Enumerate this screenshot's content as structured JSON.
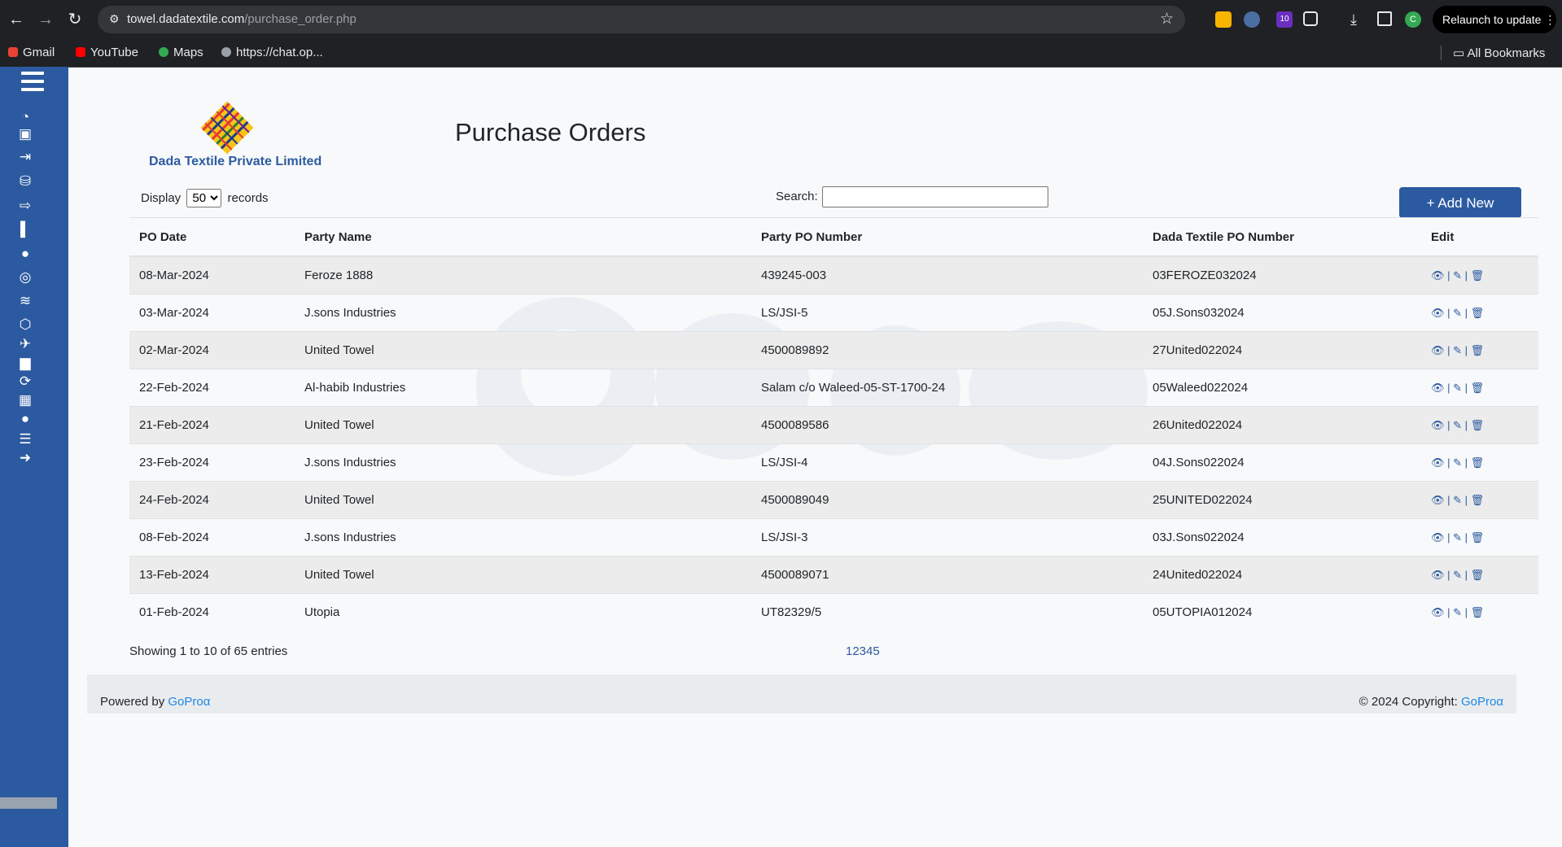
{
  "browser": {
    "url_domain": "towel.dadatextile.com",
    "url_path": "/purchase_order.php",
    "relaunch_label": "Relaunch to update",
    "ext_badge": "10",
    "profile_initial": "C",
    "bookmarks": [
      "Gmail",
      "YouTube",
      "Maps",
      "https://chat.op..."
    ],
    "all_bookmarks": "All Bookmarks"
  },
  "sidebar": {
    "icons": [
      "dashboard-icon",
      "money-icon",
      "sign-in-icon",
      "database-icon",
      "sign-out-icon",
      "book-icon",
      "comments-icon",
      "compass-icon",
      "stack-icon",
      "box-icon",
      "plane-icon",
      "trash-icon",
      "handshake-icon",
      "building-icon",
      "user-icon",
      "list-icon",
      "logout-icon"
    ]
  },
  "header": {
    "company_name": "Dada Textile Private Limited",
    "page_title": "Purchase Orders"
  },
  "controls": {
    "display_prefix": "Display",
    "display_value": "50",
    "display_suffix": "records",
    "search_label": "Search:",
    "add_new_label": "+ Add New"
  },
  "table": {
    "columns": [
      "PO Date",
      "Party Name",
      "Party PO Number",
      "Dada Textile PO Number",
      "Edit"
    ],
    "rows": [
      [
        "08-Mar-2024",
        "Feroze 1888",
        "439245-003",
        "03FEROZE032024"
      ],
      [
        "03-Mar-2024",
        "J.sons Industries",
        "LS/JSI-5",
        "05J.Sons032024"
      ],
      [
        "02-Mar-2024",
        "United Towel",
        "4500089892",
        "27United022024"
      ],
      [
        "22-Feb-2024",
        "Al-habib Industries",
        "Salam c/o Waleed-05-ST-1700-24",
        "05Waleed022024"
      ],
      [
        "21-Feb-2024",
        "United Towel",
        "4500089586",
        "26United022024"
      ],
      [
        "23-Feb-2024",
        "J.sons Industries",
        "LS/JSI-4",
        "04J.Sons022024"
      ],
      [
        "24-Feb-2024",
        "United Towel",
        "4500089049",
        "25UNITED022024"
      ],
      [
        "08-Feb-2024",
        "J.sons Industries",
        "LS/JSI-3",
        "03J.Sons022024"
      ],
      [
        "13-Feb-2024",
        "United Towel",
        "4500089071",
        "24United022024"
      ],
      [
        "01-Feb-2024",
        "Utopia",
        "UT82329/5",
        "05UTOPIA012024"
      ]
    ]
  },
  "pagination": {
    "showing": "Showing 1 to 10 of 65 entries",
    "pages": "12345"
  },
  "footer": {
    "powered_prefix": "Powered by",
    "brand": "GoProα",
    "copyright_prefix": "© 2024 Copyright:",
    "copyright_brand": "GoProα"
  },
  "colors": {
    "sidebar": "#2c5aa0",
    "accent": "#2c5aa0",
    "link": "#1e88e5"
  }
}
